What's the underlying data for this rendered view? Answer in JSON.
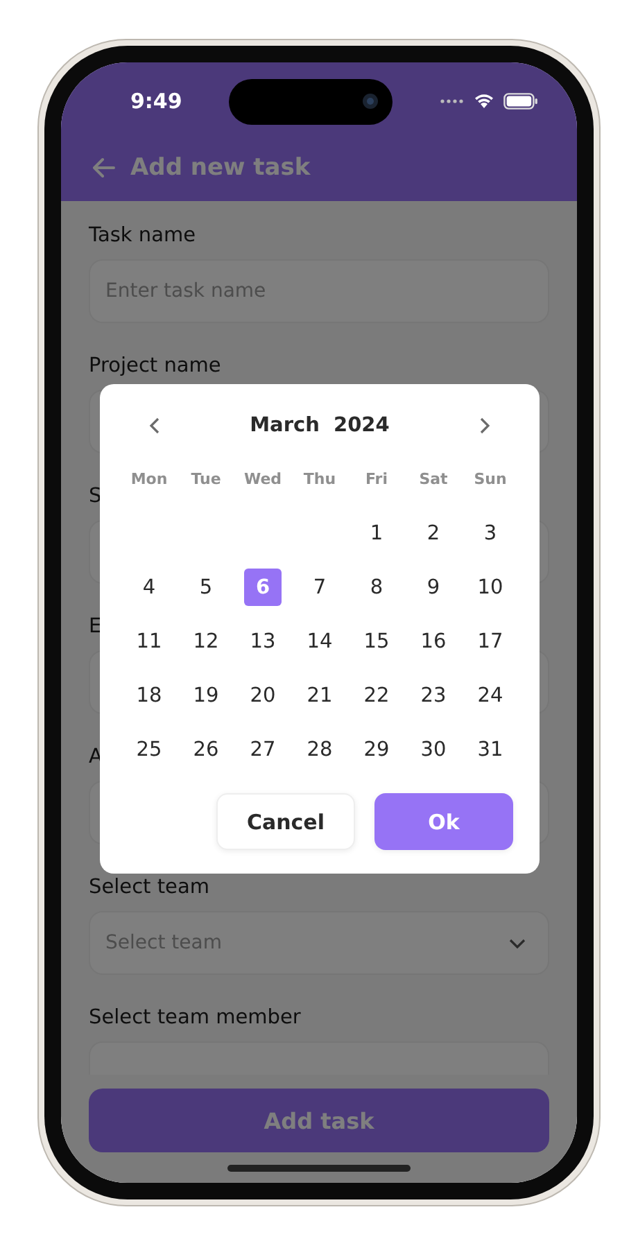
{
  "status_bar": {
    "time": "9:49"
  },
  "header": {
    "title": "Add new task"
  },
  "form": {
    "fields": [
      {
        "label": "Task name",
        "kind": "text",
        "placeholder": "Enter task name"
      },
      {
        "label": "Project name",
        "kind": "text"
      },
      {
        "label": "S",
        "kind": "text"
      },
      {
        "label": "E",
        "kind": "text"
      },
      {
        "label": "A",
        "kind": "text"
      },
      {
        "label": "Select team",
        "kind": "select",
        "placeholder": "Select team"
      },
      {
        "label": "Select team member",
        "kind": "text"
      }
    ]
  },
  "submit_button": "Add task",
  "date_picker": {
    "month_title": "March  2024",
    "weekdays": [
      "Mon",
      "Tue",
      "Wed",
      "Thu",
      "Fri",
      "Sat",
      "Sun"
    ],
    "weeks": [
      [
        {
          "day": "1",
          "selected": false
        },
        {
          "day": "2",
          "selected": false
        },
        {
          "day": "3",
          "selected": false
        }
      ],
      [
        {
          "day": "4",
          "selected": false
        },
        {
          "day": "5",
          "selected": false
        },
        {
          "day": "6",
          "selected": true
        },
        {
          "day": "7",
          "selected": false
        },
        {
          "day": "8",
          "selected": false
        },
        {
          "day": "9",
          "selected": false
        },
        {
          "day": "10",
          "selected": false
        }
      ],
      [
        {
          "day": "11",
          "selected": false
        },
        {
          "day": "12",
          "selected": false
        },
        {
          "day": "13",
          "selected": false
        },
        {
          "day": "14",
          "selected": false
        },
        {
          "day": "15",
          "selected": false
        },
        {
          "day": "16",
          "selected": false
        },
        {
          "day": "17",
          "selected": false
        }
      ],
      [
        {
          "day": "18",
          "selected": false
        },
        {
          "day": "19",
          "selected": false
        },
        {
          "day": "20",
          "selected": false
        },
        {
          "day": "21",
          "selected": false
        },
        {
          "day": "22",
          "selected": false
        },
        {
          "day": "23",
          "selected": false
        },
        {
          "day": "24",
          "selected": false
        }
      ],
      [
        {
          "day": "25",
          "selected": false
        },
        {
          "day": "26",
          "selected": false
        },
        {
          "day": "27",
          "selected": false
        },
        {
          "day": "28",
          "selected": false
        },
        {
          "day": "29",
          "selected": false
        },
        {
          "day": "30",
          "selected": false
        },
        {
          "day": "31",
          "selected": false
        }
      ]
    ],
    "buttons": [
      {
        "label": "Cancel",
        "kind": "secondary"
      },
      {
        "label": "Ok",
        "kind": "primary"
      }
    ]
  }
}
